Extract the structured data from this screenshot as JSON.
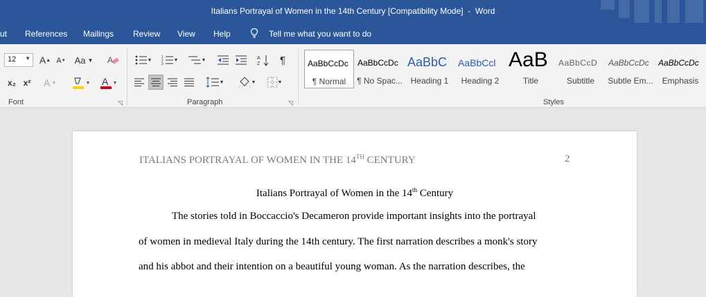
{
  "window": {
    "doc_title": "Italians Portrayal of Women in the 14th Century [Compatibility Mode]",
    "separator": "  -  ",
    "app_name": "Word"
  },
  "menu": {
    "items": [
      "ut",
      "References",
      "Mailings",
      "Review",
      "View",
      "Help"
    ],
    "tell_me": "Tell me what you want to do"
  },
  "font_group": {
    "size_value": "12",
    "label": "Font",
    "case_label": "Aa",
    "grow_label": "A",
    "shrink_label": "A",
    "subscript_label": "x₂",
    "superscript_label": "x²",
    "effects_label": "A",
    "font_color_label": "A",
    "font_color": "#d0021b",
    "highlight_color": "#ffd400"
  },
  "paragraph_group": {
    "label": "Paragraph",
    "pilcrow": "¶"
  },
  "styles_group": {
    "label": "Styles",
    "tiles": [
      {
        "sample": "AaBbCcDc",
        "name": "¶ Normal"
      },
      {
        "sample": "AaBbCcDc",
        "name": "¶ No Spac..."
      },
      {
        "sample": "AaBbC",
        "name": "Heading 1"
      },
      {
        "sample": "AaBbCcl",
        "name": "Heading 2"
      },
      {
        "sample": "AaB",
        "name": "Title"
      },
      {
        "sample": "AaBbCcD",
        "name": "Subtitle"
      },
      {
        "sample": "AaBbCcDc",
        "name": "Subtle Em..."
      },
      {
        "sample": "AaBbCcDc",
        "name": "Emphasis"
      }
    ]
  },
  "document": {
    "header_main": "ITALIANS PORTRAYAL OF WOMEN IN THE 14",
    "header_sup": "TH",
    "header_tail": " CENTURY",
    "page_number": "2",
    "title_main": "Italians Portrayal of Women in the 14",
    "title_sup": "th",
    "title_tail": " Century",
    "lines": [
      "The stories told in Boccaccio's Decameron provide important insights into the portrayal",
      "of women in medieval Italy during the 14th century. The first narration describes a monk's story",
      "and his abbot and their intention on a beautiful young woman. As the narration describes, the"
    ]
  },
  "colors": {
    "titlebar": "#2b579a",
    "ribbon": "#f3f3f3"
  }
}
